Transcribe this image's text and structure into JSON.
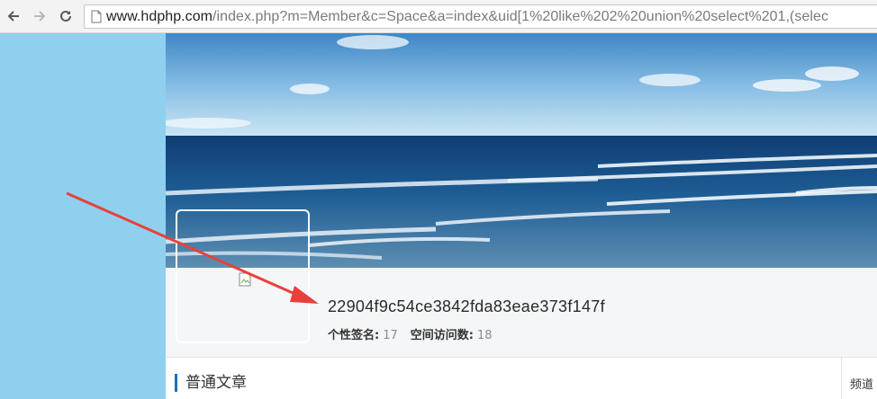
{
  "browser": {
    "url_host": "www.hdphp.com",
    "url_path": "/index.php?m=Member&c=Space&a=index&uid[1%20like%202%20union%20select%201,(selec"
  },
  "profile": {
    "username": "22904f9c54ce3842fda83eae373f147f",
    "signature_label": "个性签名:",
    "signature_value": "17",
    "visits_label": "空间访问数:",
    "visits_value": "18"
  },
  "content": {
    "section_title": "普通文章",
    "side_label": "频道"
  },
  "colors": {
    "page_background": "#8fd0ef",
    "annotation_arrow": "#e8413c",
    "section_accent": "#1b6fb8"
  },
  "icons": [
    "back-arrow-icon",
    "forward-arrow-icon",
    "reload-icon",
    "page-icon",
    "broken-image-icon"
  ]
}
